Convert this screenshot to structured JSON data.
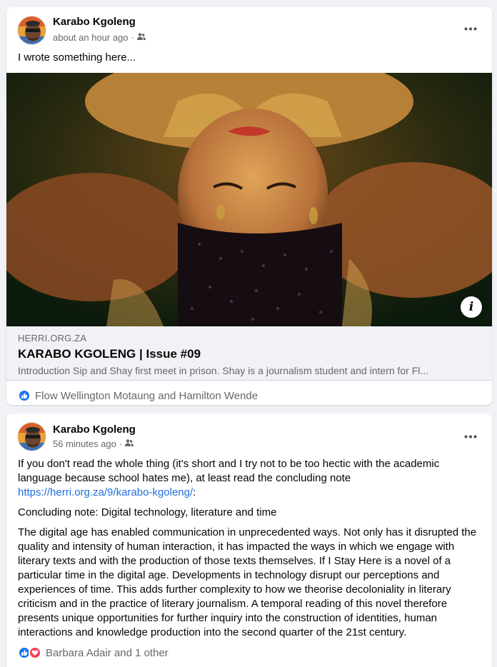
{
  "post1": {
    "author": "Karabo Kgoleng",
    "time": "about an hour ago",
    "audience_icon": "friends-icon",
    "body": "I wrote something here...",
    "link": {
      "domain": "HERRI.ORG.ZA",
      "title": "KARABO KGOLENG | Issue #09",
      "description": "Introduction Sip and Shay first meet in prison. Shay is a journalism student and intern for Fl..."
    },
    "reactions_text": "Flow Wellington Motaung and Hamilton Wende"
  },
  "post2": {
    "author": "Karabo Kgoleng",
    "time": "56 minutes ago",
    "audience_icon": "friends-icon",
    "para1_text": "If you don't read the whole thing (it's short and I try not to be too hectic with the academic language because school hates me), at least read the concluding note ",
    "para1_link": "https://herri.org.za/9/karabo-kgoleng/",
    "para1_end": ":",
    "para2": "Concluding note: Digital technology, literature and time",
    "para3": "The digital age has enabled communication in unprecedented ways. Not only has it disrupted the quality and intensity of human interaction, it has impacted the ways in which we engage with literary texts and with the production of those texts themselves. If I Stay Here is a novel of a particular time in the digital age. Developments in technology disrupt our perceptions and experiences of time. This adds further complexity to how we theorise decoloniality in literary criticism and in the practice of literary journalism. A temporal reading of this novel therefore presents unique opportunities for further inquiry into the construction of identities, human interactions and knowledge production into the second quarter of the 21st century.",
    "reactions_text": "Barbara Adair and 1 other"
  },
  "colors": {
    "link": "#216fdb",
    "like": "#1877f2",
    "love": "#f33e58",
    "secondary_text": "#65676b"
  }
}
